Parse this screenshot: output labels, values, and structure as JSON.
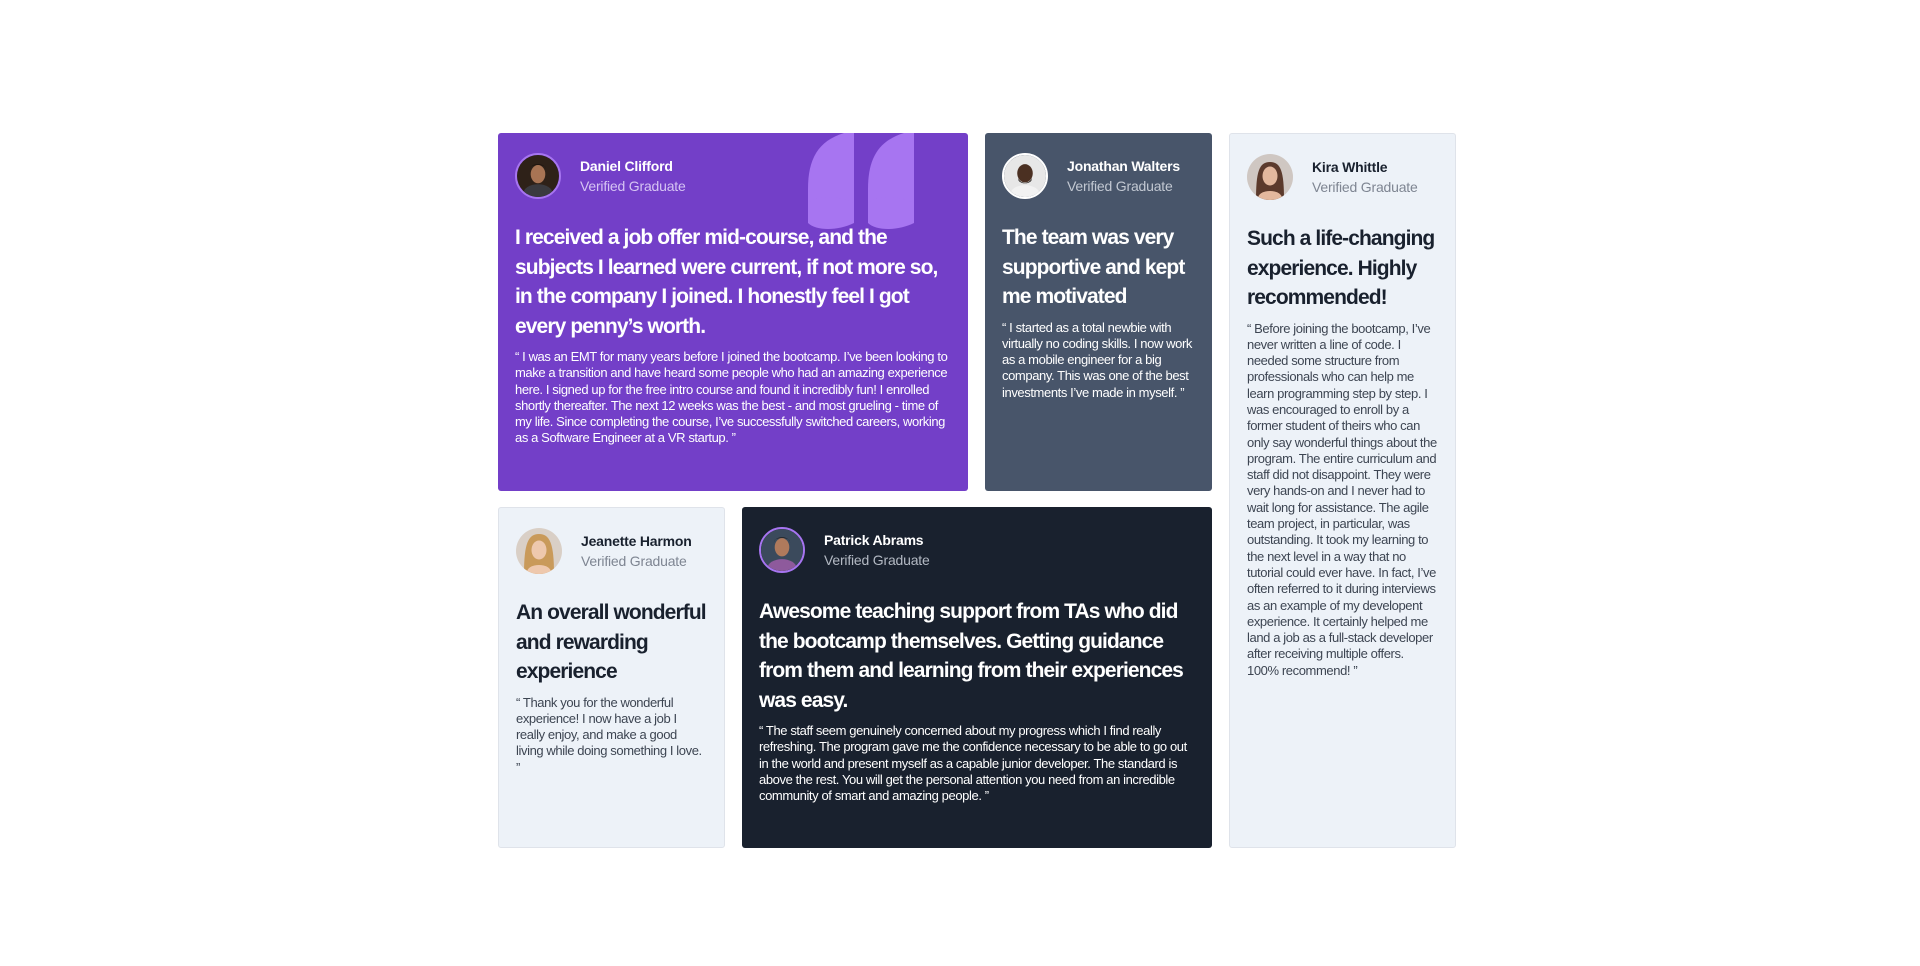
{
  "colors": {
    "purple": "#733fc8",
    "slate": "#48556a",
    "dark": "#19212e",
    "light": "#edf2f8",
    "quote_mark": "#a775f1"
  },
  "testimonials": [
    {
      "id": "daniel",
      "avatar_icon": "person-portrait-icon",
      "name": "Daniel Clifford",
      "role": "Verified Graduate",
      "headline": "I received a job offer mid-course, and the subjects I learned were current, if not more so, in the company I joined. I honestly feel I got every penny’s worth.",
      "body": "“ I was an EMT for many years before I joined the bootcamp. I’ve been looking to make a transition and have heard some people who had an amazing experience here. I signed up for the free intro course and found it incredibly fun! I enrolled shortly thereafter. The next 12 weeks was the best - and most grueling - time of my life. Since completing the course, I’ve successfully switched careers, working as a Software Engineer at a VR startup. ”"
    },
    {
      "id": "jonathan",
      "avatar_icon": "person-portrait-icon",
      "name": "Jonathan Walters",
      "role": "Verified Graduate",
      "headline": "The team was very supportive and kept me motivated",
      "body": "“ I started as a total newbie with virtually no coding skills. I now work as a mobile engineer for a big company. This was one of the best investments I’ve made in myself. ”"
    },
    {
      "id": "kira",
      "avatar_icon": "person-portrait-icon",
      "name": "Kira Whittle",
      "role": "Verified Graduate",
      "headline": "Such a life-changing experience. Highly recommended!",
      "body": "“ Before joining the bootcamp, I’ve never written a line of code. I needed some structure from professionals who can help me learn programming step by step. I was encouraged to enroll by a former student of theirs who can only say wonderful things about the program. The entire curriculum and staff did not disappoint. They were very hands-on and I never had to wait long for assistance. The agile team project, in particular, was outstanding. It took my learning to the next level in a way that no tutorial could ever have. In fact, I’ve often referred to it during interviews as an example of my developent experience. It certainly helped me land a job as a full-stack developer after receiving multiple offers. 100% recommend! ”"
    },
    {
      "id": "jeanette",
      "avatar_icon": "person-portrait-icon",
      "name": "Jeanette Harmon",
      "role": "Verified Graduate",
      "headline": "An overall wonderful and rewarding experience",
      "body": "“ Thank you for the wonderful experience! I now have a job I really enjoy, and make a good living while doing something I love. ”"
    },
    {
      "id": "patrick",
      "avatar_icon": "person-portrait-icon",
      "name": "Patrick Abrams",
      "role": "Verified Graduate",
      "headline": "Awesome teaching support from TAs who did the bootcamp themselves. Getting guidance from them and learning from their experiences was easy.",
      "body": "“ The staff seem genuinely concerned about my progress which I find really refreshing. The program gave me the confidence necessary to be able to go out in the world and present myself as a capable junior developer. The standard is above the rest. You will get the personal attention you need from an incredible community of smart and amazing people. ”"
    }
  ]
}
